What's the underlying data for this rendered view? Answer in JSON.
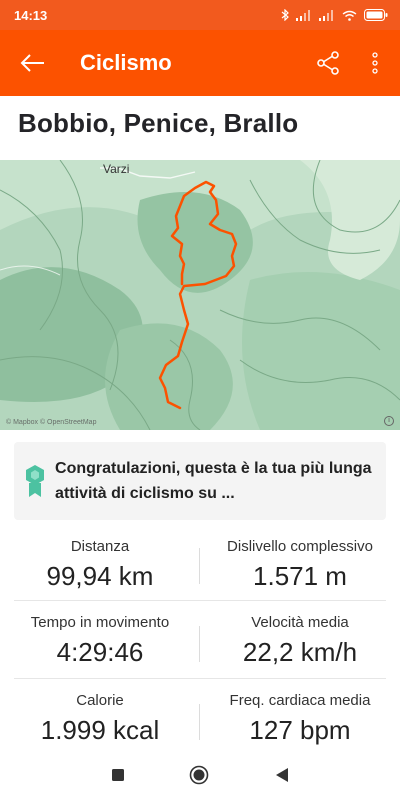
{
  "status": {
    "time": "14:13"
  },
  "app_bar": {
    "title": "Ciclismo"
  },
  "activity": {
    "title": "Bobbio, Penice, Brallo"
  },
  "map": {
    "town_label": "Varzi",
    "attribution": "© Mapbox © OpenStreetMap",
    "route_color": "#fc5200"
  },
  "achievement": {
    "text": "Congratulazioni, questa è la tua più lunga attività di ciclismo su ...",
    "icon": "badge-icon",
    "color": "#4cc2a1"
  },
  "stats": [
    {
      "label": "Distanza",
      "value": "99,94 km"
    },
    {
      "label": "Dislivello complessivo",
      "value": "1.571 m"
    },
    {
      "label": "Tempo in movimento",
      "value": "4:29:46"
    },
    {
      "label": "Velocità media",
      "value": "22,2 km/h"
    },
    {
      "label": "Calorie",
      "value": "1.999 kcal"
    },
    {
      "label": "Freq. cardiaca media",
      "value": "127 bpm"
    }
  ],
  "colors": {
    "brand": "#fc5200",
    "status_bar": "#f25a1e"
  }
}
